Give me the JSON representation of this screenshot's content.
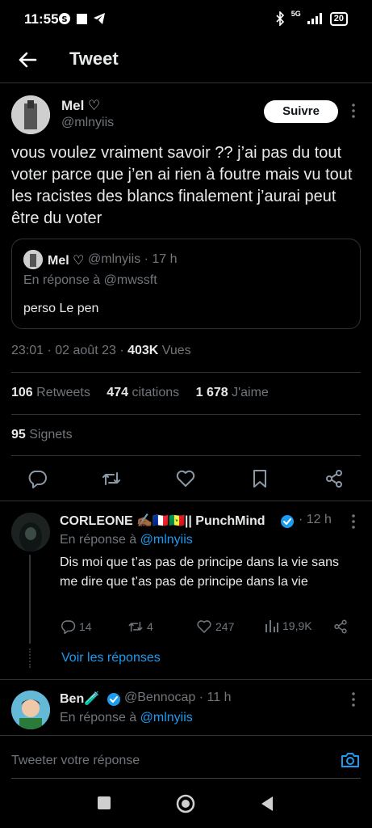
{
  "status_bar": {
    "time": "11:55",
    "network": "5G",
    "battery": "20"
  },
  "header": {
    "title": "Tweet"
  },
  "tweet": {
    "author_name": "Mel ♡",
    "author_handle": "@mlnyiis",
    "follow_label": "Suivre",
    "text": "vous voulez vraiment savoir ?? j’ai pas du tout voter parce que j’en ai rien à foutre mais vu tout les racistes des blancs finalement j’aurai peut être du voter",
    "quote": {
      "name": "Mel ♡",
      "meta": "@mlnyiis · 17 h",
      "reply_to": "En réponse à @mwssft",
      "text": "perso Le pen"
    },
    "timestamp": "23:01 · 02 août 23 · ",
    "views_count": "403K",
    "views_label": " Vues",
    "retweets_count": "106",
    "retweets_label": " Retweets",
    "quotes_count": "474",
    "quotes_label": " citations",
    "likes_count": "1 678",
    "likes_label": " J'aime",
    "bookmarks_count": "95",
    "bookmarks_label": " Signets"
  },
  "replies": [
    {
      "name": "CORLEONE ✍🏾🇫🇷🇸🇳|| PunchMind",
      "verified": true,
      "meta": "· 12 h",
      "reply_prefix": "En réponse à ",
      "reply_handle": "@mlnyiis",
      "text": "Dis moi que t’as pas de principe dans la vie sans me dire que t’as pas de principe dans la vie",
      "reply_count": "14",
      "retweet_count": "4",
      "like_count": "247",
      "view_count": "19,9K",
      "see_replies": "Voir les réponses"
    },
    {
      "name": "Ben🧪",
      "verified": true,
      "meta": "@Bennocap · 11 h",
      "reply_prefix": "En réponse à ",
      "reply_handle": "@mlnyiis"
    }
  ],
  "compose": {
    "placeholder": "Tweeter votre réponse"
  },
  "colors": {
    "background": "#000000",
    "text": "#e7e9ea",
    "muted": "#71767b",
    "accent": "#1d9bf0",
    "divider": "#2f3336"
  }
}
